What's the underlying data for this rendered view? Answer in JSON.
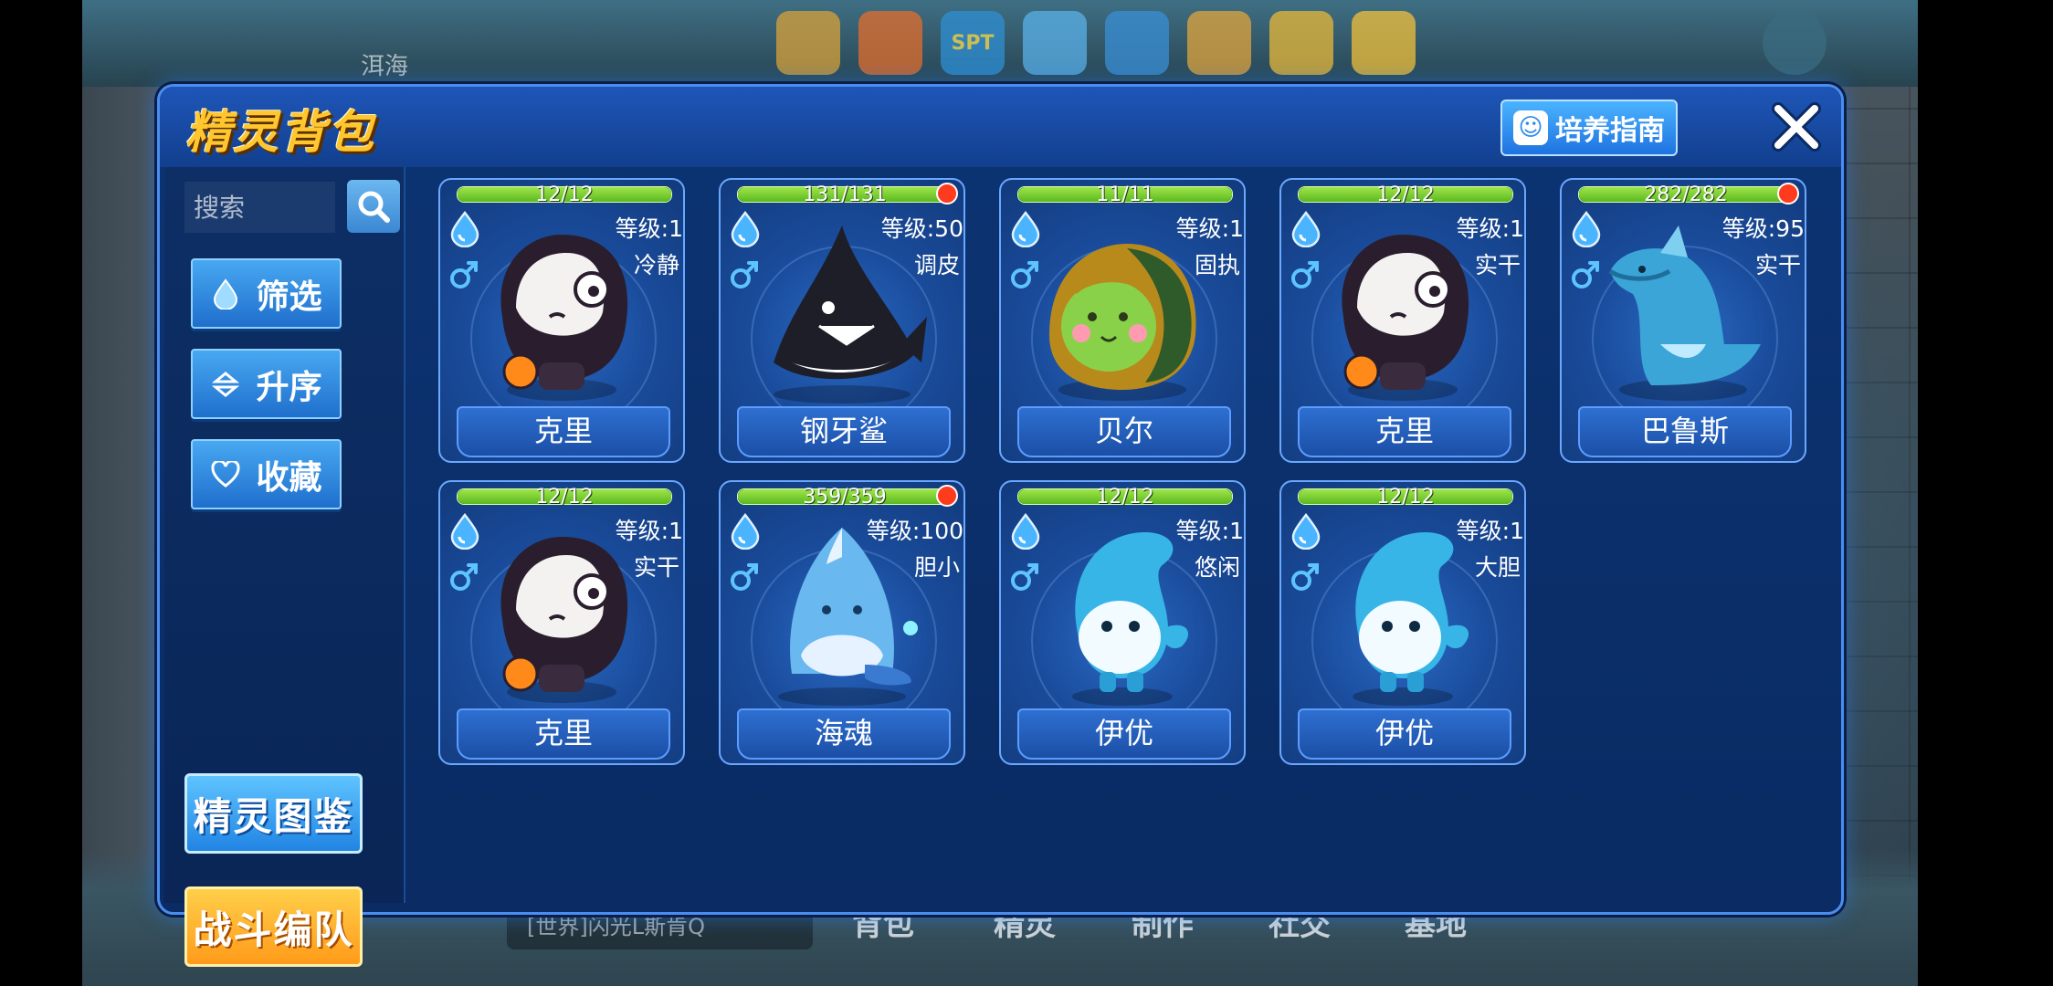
{
  "background": {
    "location": "洱海",
    "chat": "[世界]闪光L斯肯Q",
    "spt": "SPT",
    "bottom_nav": [
      "背包",
      "精灵",
      "制作",
      "社交",
      "基地"
    ]
  },
  "dialog": {
    "title": "精灵背包",
    "guide_button": "培养指南",
    "search_placeholder": "搜索",
    "filter_button": "筛选",
    "sort_button": "升序",
    "favorite_button": "收藏",
    "handbook_button": "精灵图鉴",
    "team_button": "战斗编队"
  },
  "pets": [
    {
      "name": "克里",
      "hp": "12/12",
      "hp_ratio": 1.0,
      "level": "等级:1",
      "nature": "冷静",
      "new": false,
      "species": "keli"
    },
    {
      "name": "钢牙鲨",
      "hp": "131/131",
      "hp_ratio": 1.0,
      "level": "等级:50",
      "nature": "调皮",
      "new": true,
      "species": "shark"
    },
    {
      "name": "贝尔",
      "hp": "11/11",
      "hp_ratio": 1.0,
      "level": "等级:1",
      "nature": "固执",
      "new": false,
      "species": "beier"
    },
    {
      "name": "克里",
      "hp": "12/12",
      "hp_ratio": 1.0,
      "level": "等级:1",
      "nature": "实干",
      "new": false,
      "species": "keli"
    },
    {
      "name": "巴鲁斯",
      "hp": "282/282",
      "hp_ratio": 1.0,
      "level": "等级:95",
      "nature": "实干",
      "new": true,
      "species": "balusi"
    },
    {
      "name": "克里",
      "hp": "12/12",
      "hp_ratio": 1.0,
      "level": "等级:1",
      "nature": "实干",
      "new": false,
      "species": "keli"
    },
    {
      "name": "海魂",
      "hp": "359/359",
      "hp_ratio": 1.0,
      "level": "等级:100",
      "nature": "胆小",
      "new": true,
      "species": "haihun"
    },
    {
      "name": "伊优",
      "hp": "12/12",
      "hp_ratio": 1.0,
      "level": "等级:1",
      "nature": "悠闲",
      "new": false,
      "species": "yiyou"
    },
    {
      "name": "伊优",
      "hp": "12/12",
      "hp_ratio": 1.0,
      "level": "等级:1",
      "nature": "大胆",
      "new": false,
      "species": "yiyou"
    }
  ],
  "colors": {
    "panel": "#0c3473",
    "accent": "#4a8df0",
    "hp": "#7fd43a",
    "title": "#ffc62e",
    "new_dot": "#ff3b1e"
  }
}
